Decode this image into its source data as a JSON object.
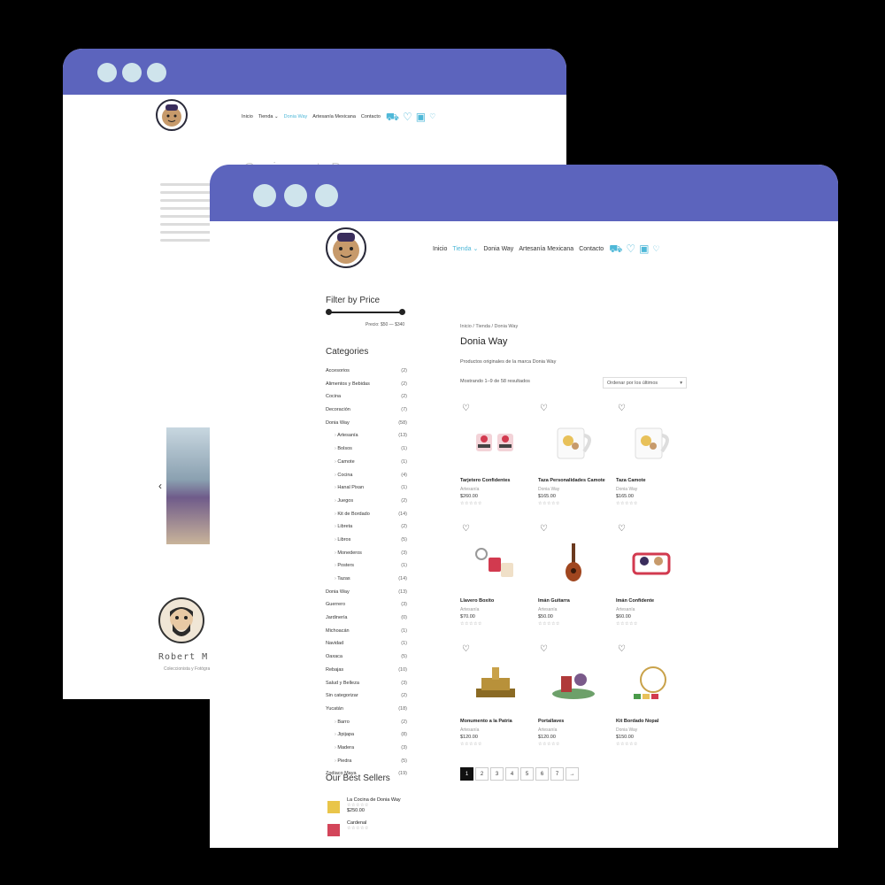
{
  "colors": {
    "titlebar": "#5c64bd",
    "accent": "#4fb8d8",
    "window_dots": "#cfe4ec"
  },
  "back_window": {
    "nav": {
      "items": [
        "Inicio",
        "Tienda ⌄",
        "Donia Way",
        "Artesanía Mexicana",
        "Contacto"
      ],
      "active_index": 2
    },
    "icons": [
      "cart-icon",
      "heart-icon",
      "calendar-icon",
      "heart-small-icon"
    ],
    "title": "¡Gracias por tu Pe...",
    "testimonial": {
      "name": "Robert M.",
      "subtitle": "Coleccionista y Fotógrafo"
    }
  },
  "front_window": {
    "nav": {
      "items": [
        "Inicio",
        "Tienda",
        "Donia Way",
        "Artesanía Mexicana",
        "Contacto"
      ],
      "active_index": 1,
      "dropdown_icon": "chevron-down-icon"
    },
    "icons": [
      "cart-icon",
      "heart-icon",
      "calendar-icon",
      "heart-small-icon"
    ],
    "sidebar": {
      "filter_heading": "Filter by Price",
      "price_label": "Precio: $50 — $340",
      "price_range": {
        "min": 50,
        "max": 340
      },
      "categories_heading": "Categories",
      "categories": [
        {
          "name": "Accesorios",
          "count": "(2)",
          "sub": false
        },
        {
          "name": "Alimentos y Bebidas",
          "count": "(2)",
          "sub": false
        },
        {
          "name": "Cocina",
          "count": "(2)",
          "sub": false
        },
        {
          "name": "Decoración",
          "count": "(7)",
          "sub": false
        },
        {
          "name": "Donia Way",
          "count": "(58)",
          "sub": false
        },
        {
          "name": "Artesanía",
          "count": "(13)",
          "sub": true
        },
        {
          "name": "Bolsos",
          "count": "(1)",
          "sub": true
        },
        {
          "name": "Camote",
          "count": "(1)",
          "sub": true
        },
        {
          "name": "Cocina",
          "count": "(4)",
          "sub": true
        },
        {
          "name": "Hanal Pixan",
          "count": "(1)",
          "sub": true
        },
        {
          "name": "Juegos",
          "count": "(2)",
          "sub": true
        },
        {
          "name": "Kit de Bordado",
          "count": "(14)",
          "sub": true
        },
        {
          "name": "Libreta",
          "count": "(2)",
          "sub": true
        },
        {
          "name": "Libros",
          "count": "(5)",
          "sub": true
        },
        {
          "name": "Monederos",
          "count": "(3)",
          "sub": true
        },
        {
          "name": "Posters",
          "count": "(1)",
          "sub": true
        },
        {
          "name": "Tazas",
          "count": "(14)",
          "sub": true
        },
        {
          "name": "Donia Way",
          "count": "(13)",
          "sub": false
        },
        {
          "name": "Guerrero",
          "count": "(3)",
          "sub": false
        },
        {
          "name": "Jardinería",
          "count": "(0)",
          "sub": false
        },
        {
          "name": "Michoacán",
          "count": "(1)",
          "sub": false
        },
        {
          "name": "Navidad",
          "count": "(1)",
          "sub": false
        },
        {
          "name": "Oaxaca",
          "count": "(5)",
          "sub": false
        },
        {
          "name": "Rebajas",
          "count": "(10)",
          "sub": false
        },
        {
          "name": "Salud y Belleza",
          "count": "(3)",
          "sub": false
        },
        {
          "name": "Sin categorizar",
          "count": "(2)",
          "sub": false
        },
        {
          "name": "Yucatán",
          "count": "(18)",
          "sub": false
        },
        {
          "name": "Barro",
          "count": "(2)",
          "sub": true
        },
        {
          "name": "Jipijapa",
          "count": "(8)",
          "sub": true
        },
        {
          "name": "Madera",
          "count": "(3)",
          "sub": true
        },
        {
          "name": "Piedra",
          "count": "(5)",
          "sub": true
        },
        {
          "name": "Zodiaco Maya",
          "count": "(19)",
          "sub": false
        }
      ],
      "best_heading": "Our Best Sellers",
      "best_sellers": [
        {
          "name": "La Cocina de Donia Way",
          "price": "$250.00",
          "stars": "☆☆☆☆☆"
        },
        {
          "name": "Cardenal",
          "price": "",
          "stars": "☆☆☆☆☆"
        }
      ]
    },
    "main": {
      "breadcrumb": "Inicio / Tienda / Donia Way",
      "title": "Donia Way",
      "description": "Productos originales de la marca Donia Way",
      "result_count": "Mostrando 1–9 de 58 resultados",
      "sort": {
        "value": "Ordenar por los últimos",
        "icon": "chevron-down-icon"
      },
      "products": [
        {
          "name": "Tarjetero Confidentes",
          "category": "Artesanía",
          "price": "$260.00",
          "stars": "☆☆☆☆☆",
          "icon": "card-holder-image"
        },
        {
          "name": "Taza Personalidades Camote",
          "category": "Donia Way",
          "price": "$165.00",
          "stars": "☆☆☆☆☆",
          "icon": "mug-image"
        },
        {
          "name": "Taza Camote",
          "category": "Donia Way",
          "price": "$165.00",
          "stars": "☆☆☆☆☆",
          "icon": "mug-image"
        },
        {
          "name": "Llavero Boxito",
          "category": "Artesanía",
          "price": "$70.00",
          "stars": "☆☆☆☆☆",
          "icon": "keychain-image"
        },
        {
          "name": "Imán Guitarra",
          "category": "Artesanía",
          "price": "$50.00",
          "stars": "☆☆☆☆☆",
          "icon": "guitar-magnet-image"
        },
        {
          "name": "Imán Confidente",
          "category": "Artesanía",
          "price": "$60.00",
          "stars": "☆☆☆☆☆",
          "icon": "magnet-image"
        },
        {
          "name": "Monumento a la Patria",
          "category": "Artesanía",
          "price": "$120.00",
          "stars": "☆☆☆☆☆",
          "icon": "monument-image"
        },
        {
          "name": "Portallaves",
          "category": "Artesanía",
          "price": "$120.00",
          "stars": "☆☆☆☆☆",
          "icon": "key-holder-image"
        },
        {
          "name": "Kit Bordado Nopal",
          "category": "Donia Way",
          "price": "$150.00",
          "stars": "☆☆☆☆☆",
          "icon": "embroidery-kit-image"
        }
      ],
      "pagination": [
        "1",
        "2",
        "3",
        "4",
        "5",
        "6",
        "7",
        "→"
      ],
      "current_page": "1"
    }
  }
}
